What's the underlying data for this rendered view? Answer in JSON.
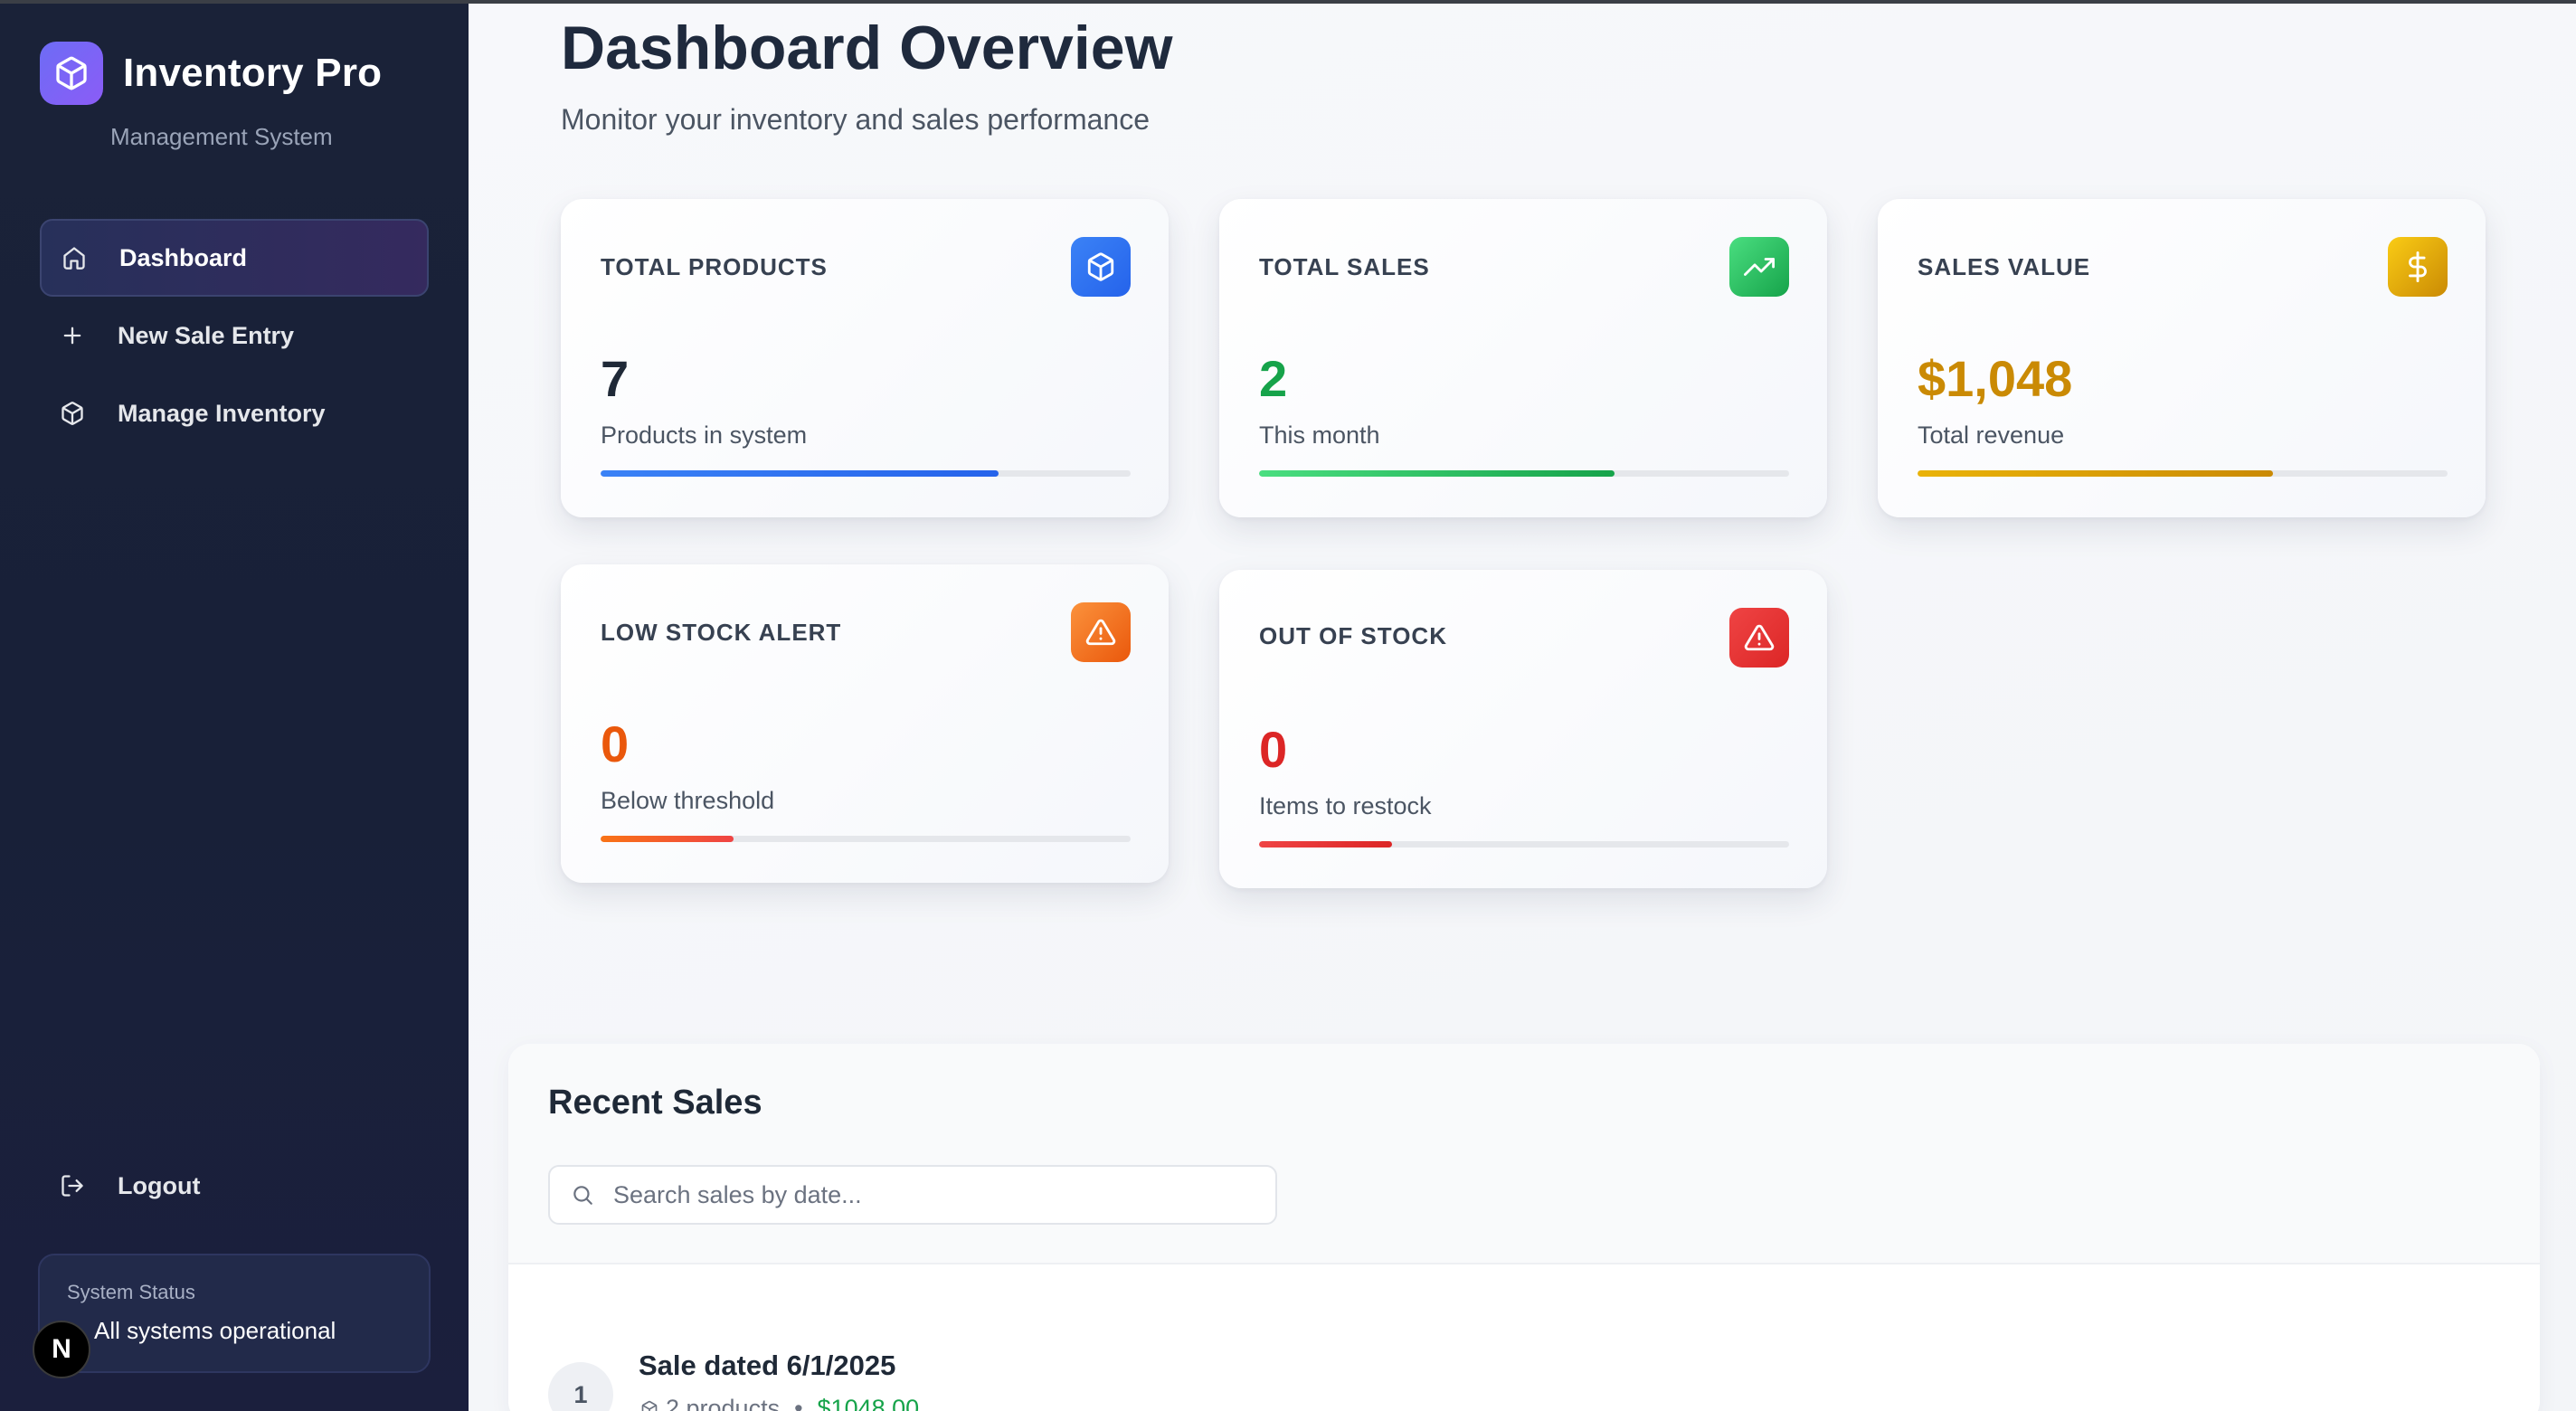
{
  "sidebar": {
    "brand_title": "Inventory Pro",
    "brand_subtitle": "Management System",
    "brand_icon": "cube-icon",
    "items": [
      {
        "label": "Dashboard",
        "icon": "home-icon",
        "active": true
      },
      {
        "label": "New Sale Entry",
        "icon": "plus-icon",
        "active": false
      },
      {
        "label": "Manage Inventory",
        "icon": "cube-icon",
        "active": false
      }
    ],
    "logout_label": "Logout",
    "status": {
      "title": "System Status",
      "text": "All systems operational"
    },
    "badge": "N"
  },
  "header": {
    "title": "Dashboard Overview",
    "subtitle": "Monitor your inventory and sales performance"
  },
  "stats": [
    {
      "title": "TOTAL PRODUCTS",
      "value": "7",
      "label": "Products in system",
      "icon": "cube-icon",
      "color": "#2563eb",
      "progress": 0.75
    },
    {
      "title": "TOTAL SALES",
      "value": "2",
      "label": "This month",
      "icon": "trending-up-icon",
      "color": "#16a34a",
      "progress": 0.67
    },
    {
      "title": "SALES VALUE",
      "value": "$1,048",
      "label": "Total revenue",
      "icon": "dollar-icon",
      "color": "#ca8a04",
      "progress": 0.67
    },
    {
      "title": "LOW STOCK ALERT",
      "value": "0",
      "label": "Below threshold",
      "icon": "alert-triangle-icon",
      "color": "#ea580c",
      "progress": 0.25
    },
    {
      "title": "OUT OF STOCK",
      "value": "0",
      "label": "Items to restock",
      "icon": "alert-triangle-icon",
      "color": "#dc2626",
      "progress": 0.25
    }
  ],
  "recent_sales": {
    "title": "Recent Sales",
    "search_placeholder": "Search sales by date...",
    "items": [
      {
        "index": "1",
        "title": "Sale dated 6/1/2025",
        "products": "2 products",
        "amount": "$1048.00"
      }
    ]
  }
}
